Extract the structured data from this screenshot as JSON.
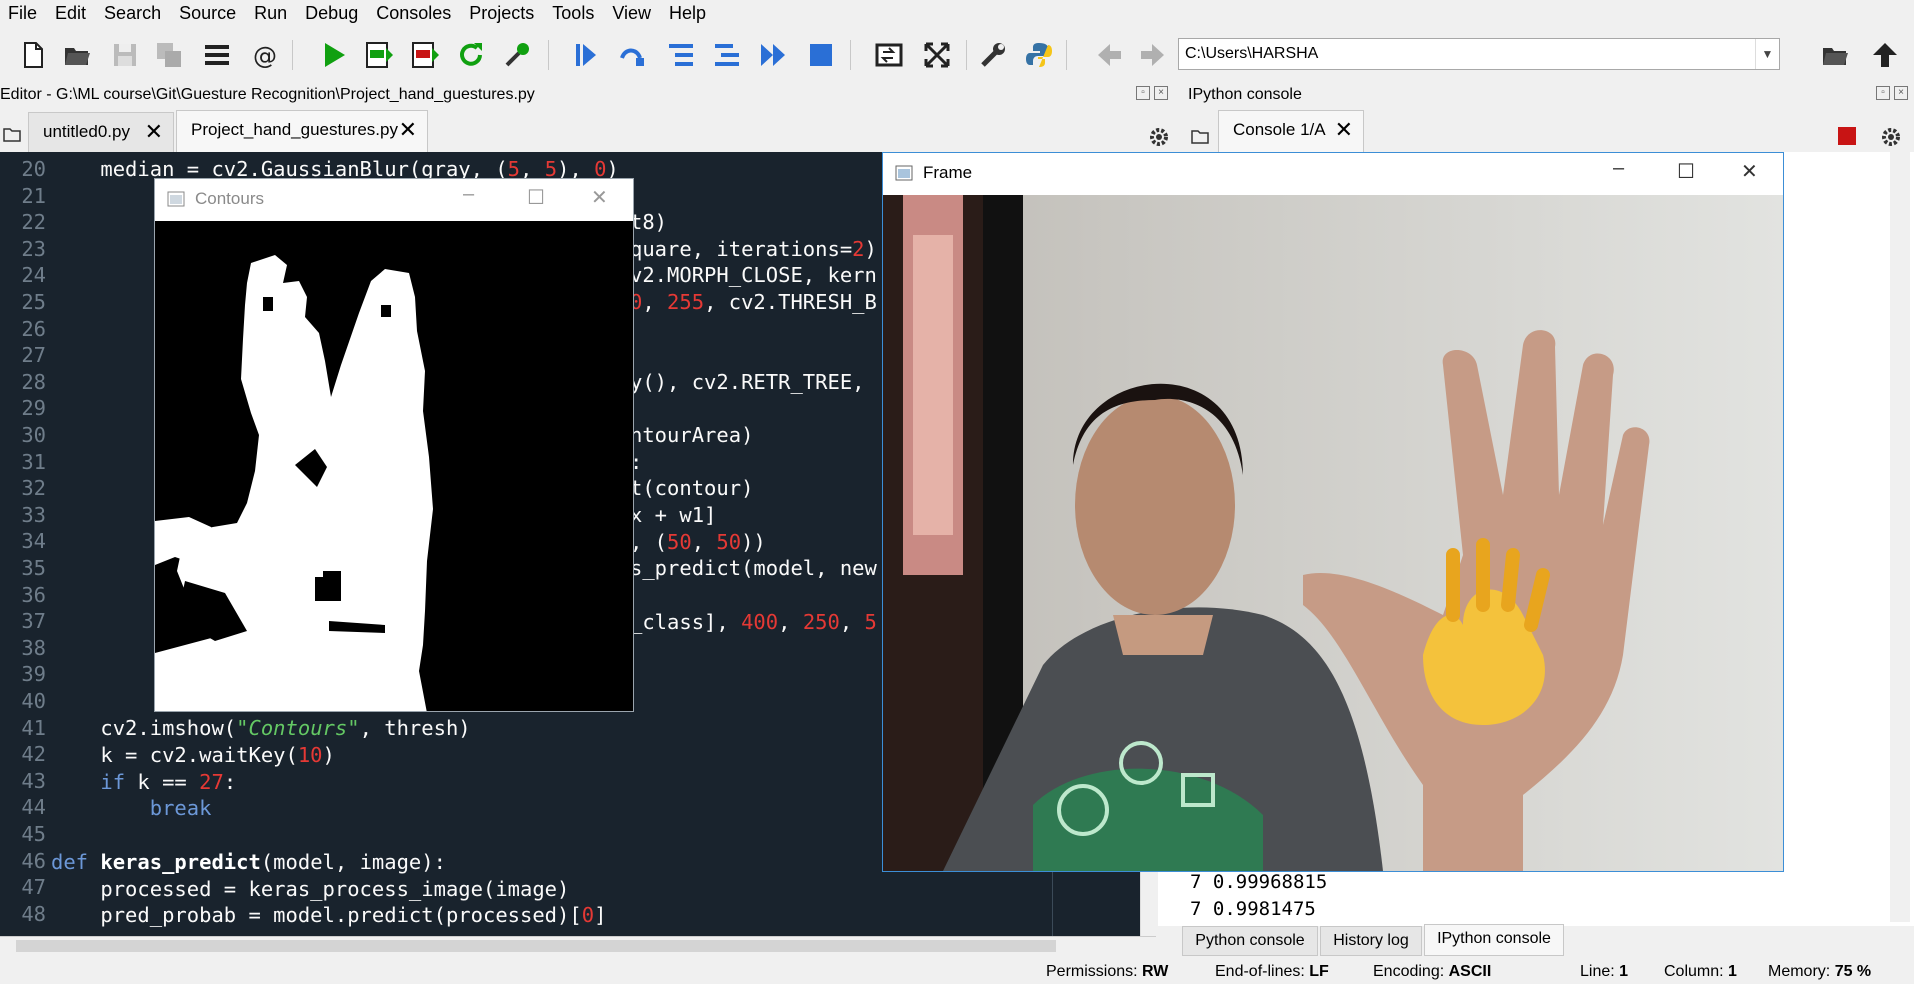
{
  "menu": [
    "File",
    "Edit",
    "Search",
    "Source",
    "Run",
    "Debug",
    "Consoles",
    "Projects",
    "Tools",
    "View",
    "Help"
  ],
  "toolbar": {
    "working_dir": "C:\\Users\\HARSHA",
    "icons": [
      "new-file",
      "open-file",
      "save",
      "save-all",
      "outline",
      "email",
      "run",
      "run-cell",
      "run-cell-advance",
      "rerun",
      "configure",
      "debug",
      "step",
      "step-into",
      "step-return",
      "continue",
      "stop",
      "maximize-pane",
      "fullscreen",
      "preferences",
      "python-path",
      "back",
      "forward",
      "browse-dir",
      "parent-dir"
    ]
  },
  "editor": {
    "title": "Editor - G:\\ML course\\Git\\Guesture Recognition\\Project_hand_guestures.py",
    "tabs": [
      "untitled0.py",
      "Project_hand_guestures.py"
    ],
    "line_numbers": [
      "20",
      "21",
      "22",
      "23",
      "24",
      "25",
      "26",
      "27",
      "28",
      "29",
      "30",
      "31",
      "32",
      "33",
      "34",
      "35",
      "36",
      "37",
      "38",
      "39",
      "40",
      "41",
      "42",
      "43",
      "44",
      "45",
      "46",
      "47",
      "48"
    ],
    "code": {
      "l20": "    median = cv2.GaussianBlur(gray, (5, 5), 0)",
      "l22": "t8)",
      "l23": "quare, iterations=2)",
      "l24": "v2.MORPH_CLOSE, kern",
      "l25": "0, 255, cv2.THRESH_B",
      "l28": "y(), cv2.RETR_TREE, ",
      "l30": "ntourArea)",
      "l31": ":",
      "l32": "t(contour)",
      "l33": "x + w1]",
      "l34": ", (50, 50))",
      "l35": "s_predict(model, new",
      "l37": "_class], 400, 250, 5",
      "l41": "    cv2.imshow(\"Contours\", thresh)",
      "l42": "    k = cv2.waitKey(10)",
      "l43": "    if k == 27:",
      "l44": "        break",
      "l46": "def keras_predict(model, image):",
      "l47": "    processed = keras_process_image(image)",
      "l48": "    pred_probab = model.predict(processed)[0]"
    }
  },
  "console": {
    "title": "IPython console",
    "tab": "Console 1/A",
    "lines": [
      "7 0.99968815",
      "7 0.9981475"
    ],
    "bottom_tabs": [
      "Python console",
      "History log",
      "IPython console"
    ]
  },
  "windows": {
    "contours_title": "Contours",
    "frame_title": "Frame"
  },
  "status": {
    "permissions_label": "Permissions:",
    "permissions_value": "RW",
    "eol_label": "End-of-lines:",
    "eol_value": "LF",
    "encoding_label": "Encoding:",
    "encoding_value": "ASCII",
    "line_label": "Line:",
    "line_value": "1",
    "column_label": "Column:",
    "column_value": "1",
    "memory_label": "Memory:",
    "memory_value": "75 %"
  },
  "colors": {
    "editor_bg": "#19232d",
    "keyword": "#6c98d8",
    "number": "#e53935",
    "string": "#64c864",
    "run_green": "#10a010",
    "stop_red": "#c81414"
  }
}
